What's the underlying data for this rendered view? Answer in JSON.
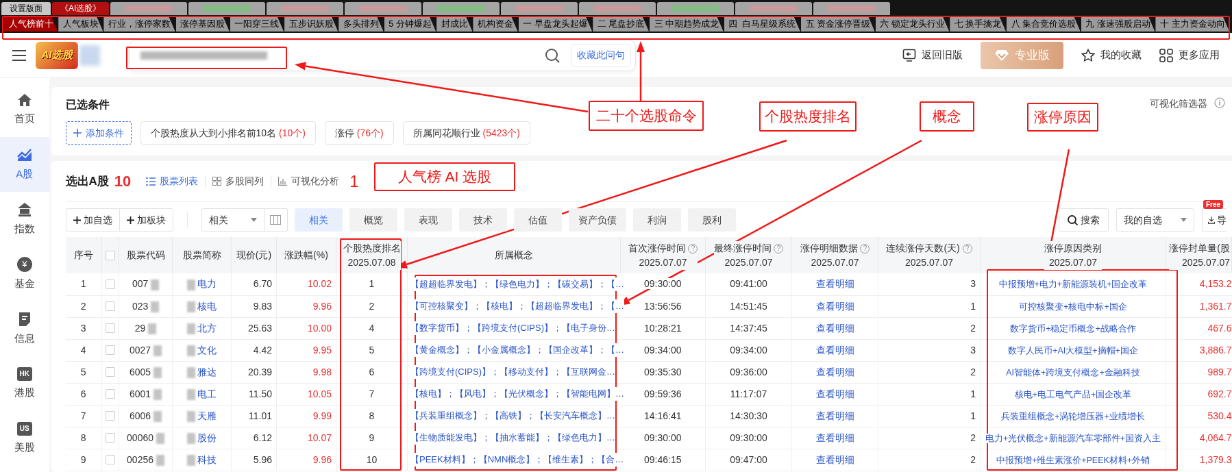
{
  "top_tabs": [
    {
      "label": "设置版面",
      "selected": false
    },
    {
      "label": "《AI选股》",
      "selected": true
    }
  ],
  "command_tabs": [
    {
      "label": "人气榜前十",
      "selected": true
    },
    {
      "label": "人气板块",
      "selected": false
    },
    {
      "label": "行业，涨停家数",
      "selected": false
    },
    {
      "label": "涨停基因股",
      "selected": false
    },
    {
      "label": "一阳穿三线",
      "selected": false
    },
    {
      "label": "五步识妖股",
      "selected": false
    },
    {
      "label": "多头排列",
      "selected": false
    },
    {
      "label": "5 分钟爆起",
      "selected": false
    },
    {
      "label": "封成比",
      "selected": false
    },
    {
      "label": "机构资金",
      "selected": false
    },
    {
      "label": "一 早盘龙头起爆",
      "selected": false
    },
    {
      "label": "二 尾盘抄底",
      "selected": false
    },
    {
      "label": "三 中期趋势成龙",
      "selected": false
    },
    {
      "label": "四  白马星级系统",
      "selected": false
    },
    {
      "label": "五 资金涨停晋级",
      "selected": false
    },
    {
      "label": "六 锁定龙头行业",
      "selected": false
    },
    {
      "label": "七 换手擒龙",
      "selected": false
    },
    {
      "label": "八 集合竞价选股",
      "selected": false
    },
    {
      "label": "九 涨速强股启动",
      "selected": false
    },
    {
      "label": "十 主力资金动向",
      "selected": false
    }
  ],
  "header": {
    "logo_text": "AI选股",
    "save_button": "收藏此问句",
    "actions": [
      {
        "kind": "back",
        "label": "返回旧版"
      },
      {
        "kind": "pro",
        "label": "专业版"
      },
      {
        "kind": "star",
        "label": "我的收藏"
      },
      {
        "kind": "grid",
        "label": "更多应用"
      }
    ]
  },
  "sidebar": {
    "items": [
      {
        "kind": "icon",
        "label": "首页",
        "selected": false
      },
      {
        "kind": "icon",
        "label": "A股",
        "selected": true
      },
      {
        "kind": "icon",
        "label": "指数",
        "selected": false
      },
      {
        "kind": "round_badge",
        "badge": "¥",
        "label": "基金",
        "selected": false
      },
      {
        "kind": "icon",
        "label": "信息",
        "selected": false
      },
      {
        "kind": "square_badge",
        "badge": "HK",
        "label": "港股",
        "selected": false
      },
      {
        "kind": "square_badge",
        "badge": "US",
        "label": "美股",
        "selected": false
      }
    ]
  },
  "conditions": {
    "title": "已选条件",
    "add": "添加条件",
    "chips": [
      {
        "label": "个股热度从大到小排名前10名",
        "count": "(10个)"
      },
      {
        "label": "涨停",
        "count": "(76个)"
      },
      {
        "label": "所属同花顺行业",
        "count": "(5423个)"
      }
    ],
    "visual_filter": "可视化筛选器"
  },
  "results": {
    "title": "选出A股",
    "count": "10",
    "views": [
      {
        "label": "股票列表",
        "selected": true
      },
      {
        "label": "多股同列",
        "selected": false
      },
      {
        "label": "可视化分析",
        "selected": false
      }
    ]
  },
  "toolbar": {
    "buttons": [
      "加自选",
      "加板块"
    ],
    "sort": "相关",
    "tabs": [
      {
        "label": "相关",
        "selected": true
      },
      {
        "label": "概览",
        "selected": false
      },
      {
        "label": "表现",
        "selected": false
      },
      {
        "label": "技术",
        "selected": false
      },
      {
        "label": "估值",
        "selected": false
      },
      {
        "label": "资产负债",
        "selected": false
      },
      {
        "label": "利润",
        "selected": false
      },
      {
        "label": "股利",
        "selected": false
      }
    ],
    "search": "搜索",
    "watchlist": "我的自选",
    "export": "导",
    "export_badge": "Free"
  },
  "table": {
    "columns": [
      {
        "kind": "text",
        "label": "序号"
      },
      {
        "kind": "checkbox",
        "checked": false
      },
      {
        "kind": "text",
        "label": "股票代码"
      },
      {
        "kind": "text",
        "label": "股票简称"
      },
      {
        "kind": "text",
        "label": "现价(元)"
      },
      {
        "kind": "text",
        "label": "涨跌幅(%)"
      },
      {
        "kind": "text",
        "label": "个股热度排名",
        "date": "2025.07.08"
      },
      {
        "kind": "text",
        "label": "所属概念"
      },
      {
        "kind": "text",
        "label": "首次涨停时间",
        "help": "?",
        "date": "2025.07.07"
      },
      {
        "kind": "text",
        "label": "最终涨停时间",
        "help": "?",
        "date": "2025.07.07"
      },
      {
        "kind": "text",
        "label": "涨停明细数据",
        "help": "?",
        "date": "2025.07.07"
      },
      {
        "kind": "text",
        "label": "连续涨停天数(天)",
        "help": "?",
        "date": "2025.07.07"
      },
      {
        "kind": "text",
        "label": "涨停原因类别",
        "date": "2025.07.07"
      },
      {
        "kind": "text",
        "label": "涨停封单量(股",
        "date": "2025.07.07"
      }
    ],
    "rows": [
      {
        "no": "1",
        "checked": false,
        "code": "007",
        "name": "电力",
        "price": "6.70",
        "change": "10.02",
        "rank": "1",
        "concepts": "【超超临界发电】；【绿色电力】；【碳交易】；【…",
        "first_time": "09:30:00",
        "last_time": "09:41:00",
        "detail": "查看明细",
        "days": "3",
        "reason": "中报预增+电力+新能源装机+国企改革",
        "seal": "4,153.2"
      },
      {
        "no": "2",
        "checked": false,
        "code": "023",
        "name": "核电",
        "price": "9.83",
        "change": "9.96",
        "rank": "2",
        "concepts": "【可控核聚变】；【核电】；【超超临界发电】；【…",
        "first_time": "13:56:56",
        "last_time": "14:51:45",
        "detail": "查看明细",
        "days": "1",
        "reason": "可控核聚变+核电中标+国企",
        "seal": "1,361.7"
      },
      {
        "no": "3",
        "checked": false,
        "code": "29",
        "name": "北方",
        "price": "25.63",
        "change": "10.00",
        "rank": "4",
        "concepts": "【数字货币】；【跨境支付(CIPS)】；【电子身份…",
        "first_time": "10:28:21",
        "last_time": "14:37:45",
        "detail": "查看明细",
        "days": "2",
        "reason": "数字货币+稳定币概念+战略合作",
        "seal": "467.6"
      },
      {
        "no": "4",
        "checked": false,
        "code": "0027",
        "name": "文化",
        "price": "4.42",
        "change": "9.95",
        "rank": "5",
        "concepts": "【黄金概念】；【小金属概念】；【国企改革】；【…",
        "first_time": "09:34:00",
        "last_time": "09:34:00",
        "detail": "查看明细",
        "days": "3",
        "reason": "数字人民币+AI大模型+摘帽+国企",
        "seal": "3,886.7"
      },
      {
        "no": "5",
        "checked": false,
        "code": "6005",
        "name": "雅达",
        "price": "20.39",
        "change": "9.98",
        "rank": "6",
        "concepts": "【跨境支付(CIPS)】；【移动支付】；【互联网金…",
        "first_time": "09:35:30",
        "last_time": "09:36:00",
        "detail": "查看明细",
        "days": "2",
        "reason": "AI智能体+跨境支付概念+金融科技",
        "seal": "989.7"
      },
      {
        "no": "6",
        "checked": false,
        "code": "6001",
        "name": "电工",
        "price": "11.50",
        "change": "10.05",
        "rank": "7",
        "concepts": "【核电】；【风电】；【光伏概念】；【智能电网】…",
        "first_time": "09:59:36",
        "last_time": "11:17:07",
        "detail": "查看明细",
        "days": "1",
        "reason": "核电+电工电气产品+国企改革",
        "seal": "692.7"
      },
      {
        "no": "7",
        "checked": false,
        "code": "6006",
        "name": "天雁",
        "price": "11.01",
        "change": "9.99",
        "rank": "8",
        "concepts": "【兵装重组概念】；【高铁】；【长安汽车概念】…",
        "first_time": "14:16:41",
        "last_time": "14:30:30",
        "detail": "查看明细",
        "days": "1",
        "reason": "兵装重组概念+涡轮增压器+业绩增长",
        "seal": "530.4"
      },
      {
        "no": "8",
        "checked": false,
        "code": "00060",
        "name": "股份",
        "price": "6.12",
        "change": "10.07",
        "rank": "9",
        "concepts": "【生物质能发电】；【抽水蓄能】；【绿色电力】…",
        "first_time": "09:30:00",
        "last_time": "09:30:00",
        "detail": "查看明细",
        "days": "2",
        "reason": "电力+光伏概念+新能源汽车零部件+国资入主",
        "seal": "4,064.7"
      },
      {
        "no": "9",
        "checked": false,
        "code": "00256",
        "name": "科技",
        "price": "5.96",
        "change": "9.96",
        "rank": "10",
        "concepts": "【PEEK材料】；【NMN概念】；【维生素】；【合…",
        "first_time": "09:46:15",
        "last_time": "09:47:00",
        "detail": "查看明细",
        "days": "2",
        "reason": "中报预增+维生素涨价+PEEK材料+外销",
        "seal": "1,379.3"
      }
    ]
  },
  "annotations": [
    {
      "kind": "boxed",
      "text": "二十个选股命令"
    },
    {
      "kind": "boxed",
      "text": "个股热度排名"
    },
    {
      "kind": "boxed",
      "text": "概念"
    },
    {
      "kind": "boxed",
      "text": "涨停原因"
    },
    {
      "kind": "plain",
      "text": "1"
    },
    {
      "kind": "boxed",
      "text": "人气榜 AI 选股"
    }
  ]
}
